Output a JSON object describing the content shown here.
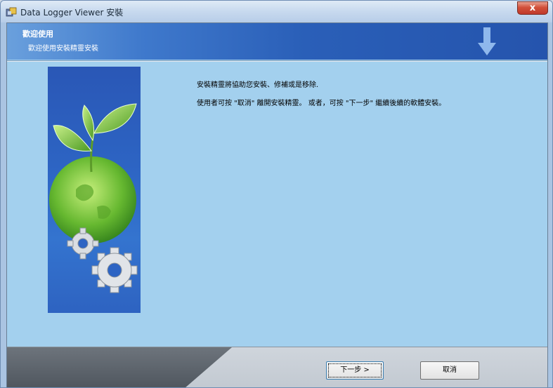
{
  "window": {
    "title": "Data Logger Viewer 安裝",
    "close_label": "x"
  },
  "header": {
    "title": "歡迎使用",
    "subtitle": "歡迎使用安裝精靈安裝"
  },
  "content": {
    "paragraph1": "安裝精靈將協助您安裝、修補或是移除.",
    "paragraph2": "使用者可按 \"取消\" 離開安裝精靈。 或者，可按 \"下一步\" 繼續後續的軟體安裝。"
  },
  "buttons": {
    "next_label": "下一步 >",
    "cancel_label": "取消"
  },
  "colors": {
    "banner": "#2a5fb8",
    "content_bg": "#a3d0ee",
    "footer_dark": "#4e555d"
  }
}
